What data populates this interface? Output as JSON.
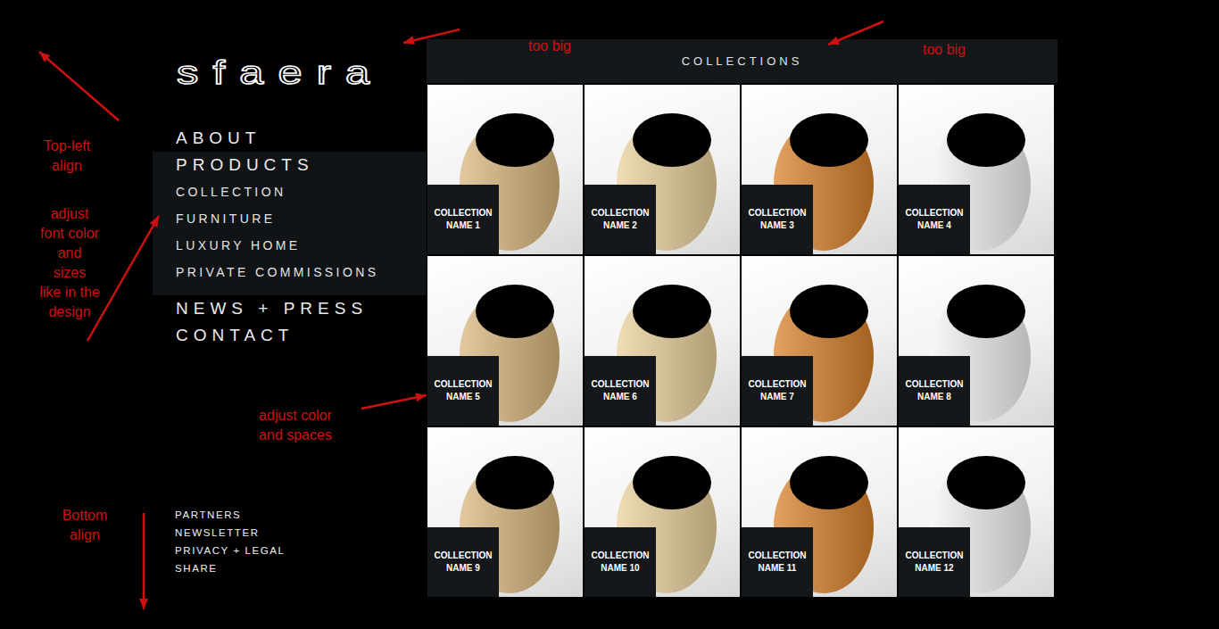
{
  "logo": "sfaera",
  "nav": {
    "items": [
      {
        "label": "ABOUT",
        "expanded": false,
        "children": []
      },
      {
        "label": "PRODUCTS",
        "expanded": true,
        "children": [
          "COLLECTION",
          "FURNITURE",
          "LUXURY HOME",
          "PRIVATE COMMISSIONS"
        ]
      },
      {
        "label": "NEWS + PRESS",
        "expanded": false,
        "children": []
      },
      {
        "label": "CONTACT",
        "expanded": false,
        "children": []
      }
    ]
  },
  "footer": {
    "links": [
      "PARTNERS",
      "NEWSLETTER",
      "PRIVACY + LEGAL",
      "SHARE"
    ]
  },
  "collections": {
    "title": "COLLECTIONS",
    "tiles": [
      {
        "lines": [
          "COLLECTION",
          "NAME 1"
        ],
        "color": "#d9b77e"
      },
      {
        "lines": [
          "COLLECTION",
          "NAME 2"
        ],
        "color": "#ebd29e"
      },
      {
        "lines": [
          "COLLECTION",
          "NAME 3"
        ],
        "color": "#d9822b"
      },
      {
        "lines": [
          "COLLECTION",
          "NAME 4"
        ],
        "color": "#f4f4f4"
      },
      {
        "lines": [
          "COLLECTION",
          "NAME 5"
        ],
        "color": "#d9b77e"
      },
      {
        "lines": [
          "COLLECTION",
          "NAME 6"
        ],
        "color": "#ebd29e"
      },
      {
        "lines": [
          "COLLECTION",
          "NAME 7"
        ],
        "color": "#d9822b"
      },
      {
        "lines": [
          "COLLECTION",
          "NAME 8"
        ],
        "color": "#f4f4f4"
      },
      {
        "lines": [
          "COLLECTION",
          "NAME 9"
        ],
        "color": "#d9b77e"
      },
      {
        "lines": [
          "COLLECTION",
          "NAME 10"
        ],
        "color": "#ebd29e"
      },
      {
        "lines": [
          "COLLECTION",
          "NAME 11"
        ],
        "color": "#d9822b"
      },
      {
        "lines": [
          "COLLECTION",
          "NAME 12"
        ],
        "color": "#f4f4f4"
      }
    ]
  },
  "annotations": [
    {
      "lines": [
        "too big"
      ]
    },
    {
      "lines": [
        "too big"
      ]
    },
    {
      "lines": [
        "Top-left",
        "align"
      ]
    },
    {
      "lines": [
        "adjust",
        "font color",
        "and",
        "sizes",
        "like in the",
        "design"
      ]
    },
    {
      "lines": [
        "adjust color",
        "and spaces"
      ]
    },
    {
      "lines": [
        "Bottom",
        "align"
      ]
    }
  ]
}
